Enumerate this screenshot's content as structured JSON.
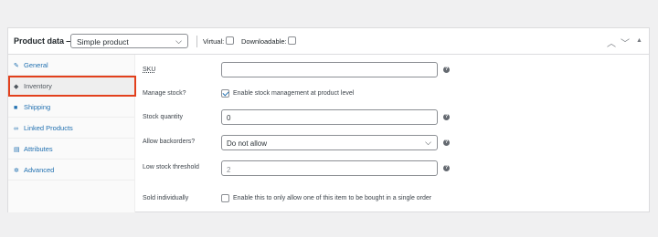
{
  "header": {
    "title": "Product data —",
    "product_type": "Simple product",
    "virtual_label": "Virtual:",
    "virtual_checked": false,
    "downloadable_label": "Downloadable:",
    "downloadable_checked": false,
    "controls": [
      "chevron-up-icon",
      "chevron-down-icon",
      "triangle-up-icon"
    ]
  },
  "tabs": [
    {
      "label": "General",
      "icon": "wrench-icon"
    },
    {
      "label": "Inventory",
      "icon": "tag-icon",
      "active": true
    },
    {
      "label": "Shipping",
      "icon": "truck-icon"
    },
    {
      "label": "Linked Products",
      "icon": "link-icon"
    },
    {
      "label": "Attributes",
      "icon": "list-icon"
    },
    {
      "label": "Advanced",
      "icon": "gear-icon"
    }
  ],
  "fields": {
    "sku": {
      "label": "SKU",
      "value": ""
    },
    "manage_stock": {
      "label": "Manage stock?",
      "checked": true,
      "description": "Enable stock management at product level"
    },
    "stock_quantity": {
      "label": "Stock quantity",
      "value": "0"
    },
    "backorders": {
      "label": "Allow backorders?",
      "value": "Do not allow"
    },
    "low_stock": {
      "label": "Low stock threshold",
      "placeholder": "2"
    },
    "sold_individually": {
      "label": "Sold individually",
      "checked": false,
      "description": "Enable this to only allow one of this item to be bought in a single order"
    }
  },
  "help_glyph": "?",
  "colors": {
    "link": "#2271b1",
    "highlight": "#e2401c"
  }
}
